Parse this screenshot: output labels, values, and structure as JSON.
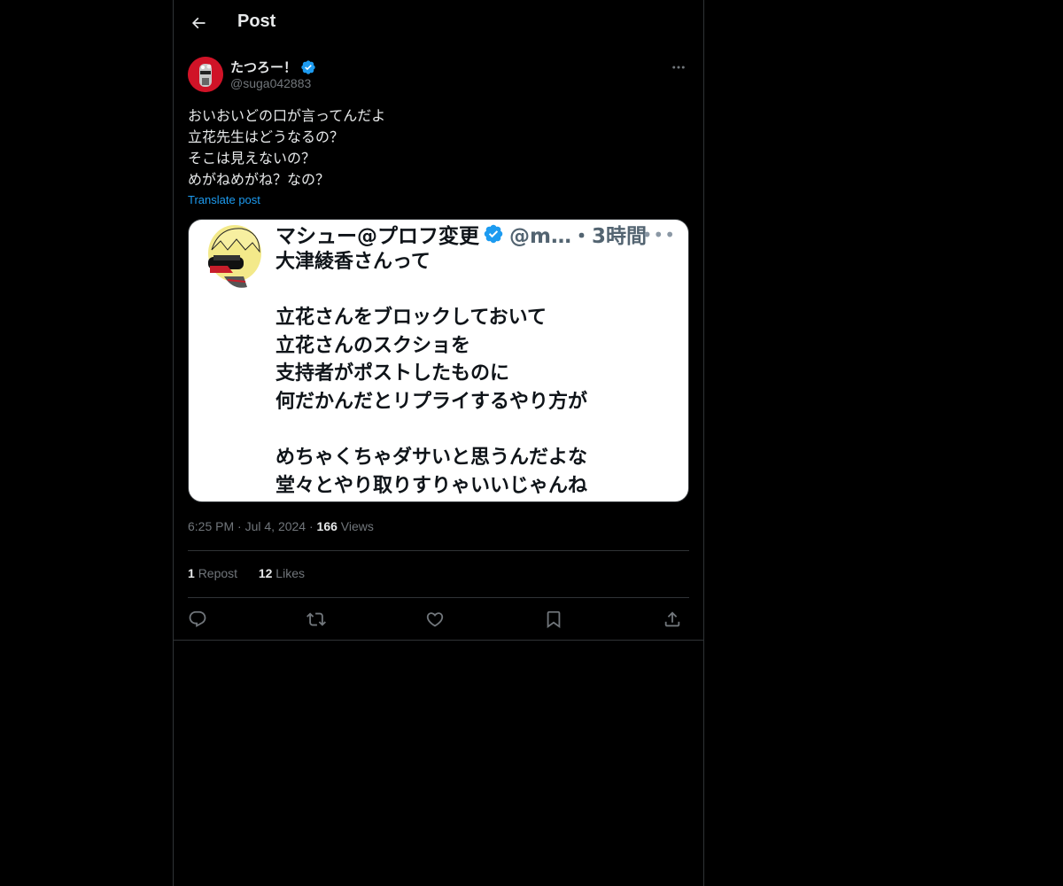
{
  "header": {
    "title": "Post",
    "back_icon": "arrow-left-icon"
  },
  "post": {
    "author": {
      "display_name": "たつろー！",
      "handle": "@suga042883",
      "verified": true
    },
    "text_lines": [
      "おいおいどの口が言ってんだよ",
      "立花先生はどうなるの？",
      "そこは見えないの？",
      "めがねめがね？なの？"
    ],
    "translate_label": "Translate post",
    "media": {
      "name": "マシュー@プロフ変更",
      "handle_time": "@m…・3時間",
      "text_lines": [
        "大津綾香さんって",
        "",
        "立花さんをブロックしておいて",
        "立花さんのスクショを",
        "支持者がポストしたものに",
        "何だかんだとリプライするやり方が",
        "",
        "めちゃくちゃダサいと思うんだよな",
        "堂々とやり取りすりゃいいじゃんね"
      ]
    },
    "time": "6:25 PM",
    "date": "Jul 4, 2024",
    "views_count": "166",
    "views_label": "Views",
    "reposts_count": "1",
    "reposts_label": "Repost",
    "likes_count": "12",
    "likes_label": "Likes"
  },
  "colors": {
    "background": "#000000",
    "text": "#e7e9ea",
    "muted": "#71767b",
    "accent": "#1d9bf0",
    "border": "#2f3336"
  },
  "icons": {
    "reply": "reply-icon",
    "repost": "repost-icon",
    "like": "heart-icon",
    "bookmark": "bookmark-icon",
    "share": "share-icon"
  }
}
